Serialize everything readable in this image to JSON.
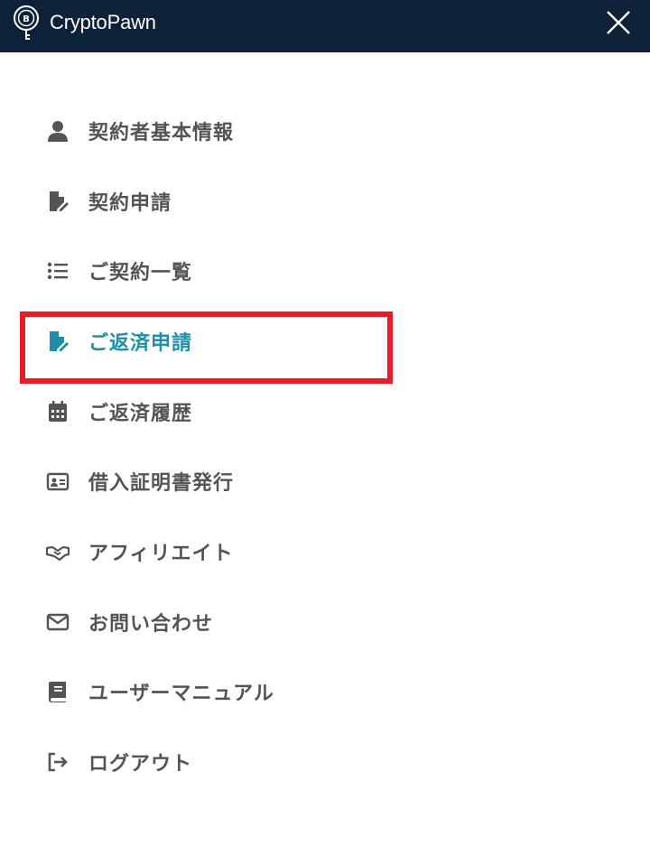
{
  "header": {
    "brand_name": "CryptoPawn",
    "brand_color": "#0d2138"
  },
  "menu": {
    "active_color": "#1e8fa6",
    "text_color": "#545454",
    "items": [
      {
        "label": "契約者基本情報",
        "icon": "user-icon"
      },
      {
        "label": "契約申請",
        "icon": "file-edit-icon"
      },
      {
        "label": "ご契約一覧",
        "icon": "list-icon"
      },
      {
        "label": "ご返済申請",
        "icon": "file-edit-icon",
        "active": true,
        "highlighted": true
      },
      {
        "label": "ご返済履歴",
        "icon": "calendar-icon"
      },
      {
        "label": "借入証明書発行",
        "icon": "id-card-icon"
      },
      {
        "label": "アフィリエイト",
        "icon": "handshake-icon"
      },
      {
        "label": "お問い合わせ",
        "icon": "envelope-icon"
      },
      {
        "label": "ユーザーマニュアル",
        "icon": "book-icon"
      },
      {
        "label": "ログアウト",
        "icon": "sign-out-icon"
      }
    ]
  },
  "highlight_color": "#e31e28"
}
